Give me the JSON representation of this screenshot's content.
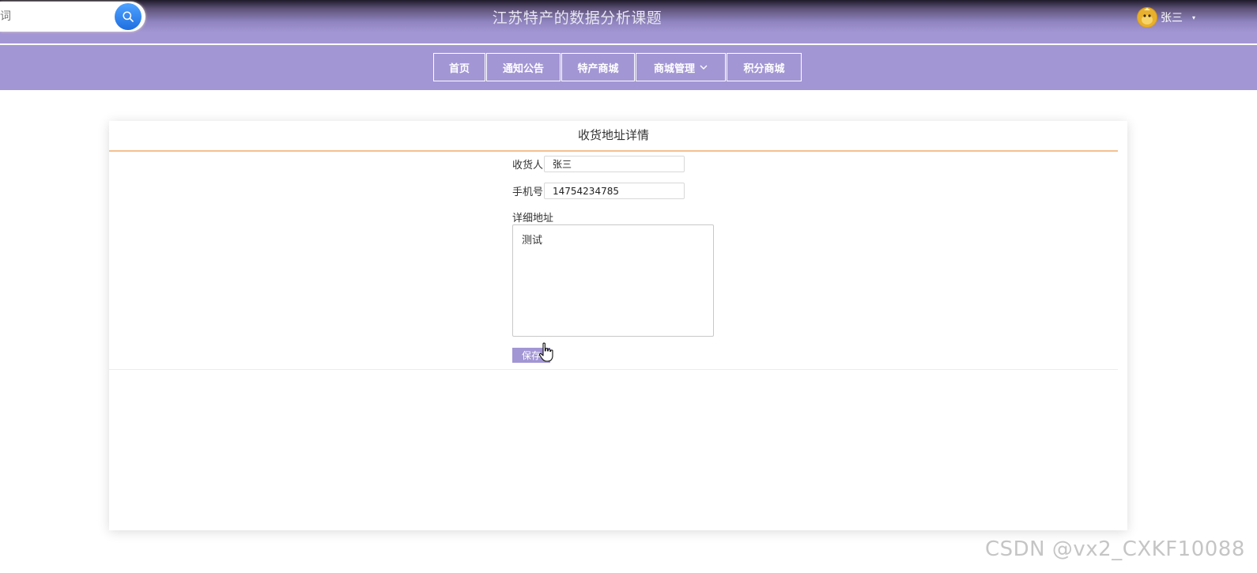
{
  "header": {
    "search_placeholder": "词",
    "site_title": "江苏特产的数据分析课题",
    "user_name": "张三",
    "user_caret": "▾"
  },
  "nav": {
    "items": [
      {
        "label": "首页"
      },
      {
        "label": "通知公告"
      },
      {
        "label": "特产商城"
      },
      {
        "label": "商城管理",
        "has_dropdown": true
      },
      {
        "label": "积分商城"
      }
    ]
  },
  "address_detail": {
    "title": "收货地址详情",
    "recipient_label": "收货人",
    "recipient_value": "张三",
    "phone_label": "手机号",
    "phone_value": "14754234785",
    "address_label": "详细地址",
    "address_value": "测试",
    "save_label": "保存"
  },
  "watermark": "CSDN @vx2_CXKF10088",
  "colors": {
    "theme_purple": "#a396d4",
    "title_underline": "#f3c08f",
    "search_button": "#2b7fe8"
  }
}
